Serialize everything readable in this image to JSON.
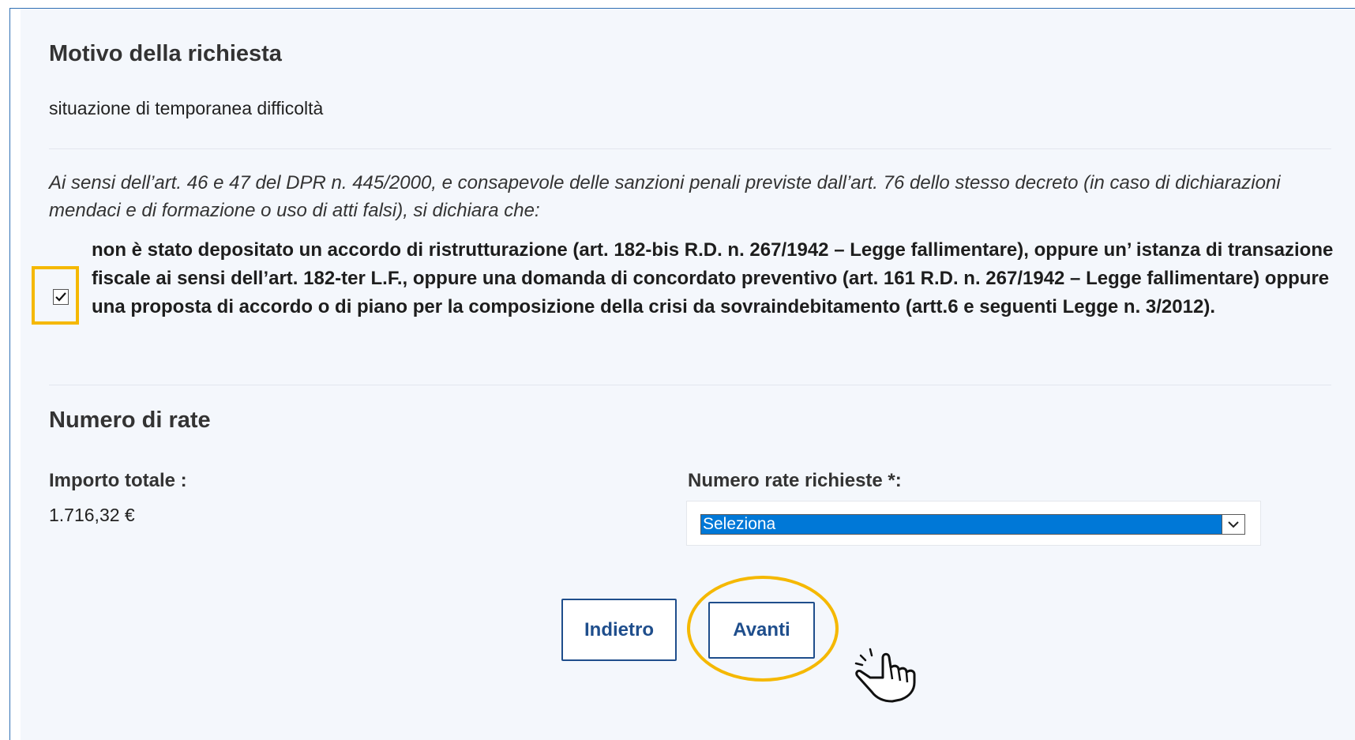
{
  "motivo": {
    "title": "Motivo della richiesta",
    "value": "situazione di temporanea difficoltà"
  },
  "declaration": {
    "intro": "Ai sensi dell’art. 46 e 47 del DPR n. 445/2000, e consapevole delle sanzioni penali previste dall’art. 76 dello stesso decreto (in caso di dichiarazioni mendaci e di formazione o uso di atti falsi), si dichiara che:",
    "checkbox_checked": true,
    "checkbox_text": "non è stato depositato un accordo di ristrutturazione (art. 182-bis R.D. n. 267/1942 – Legge fallimentare), oppure un’ istanza di transazione fiscale ai sensi dell’art. 182-ter L.F., oppure una domanda di concordato preventivo (art. 161 R.D. n. 267/1942 – Legge fallimentare) oppure una proposta di accordo o di piano per la composizione della crisi da sovraindebitamento (artt.6 e seguenti Legge n. 3/2012)."
  },
  "rate": {
    "title": "Numero di rate",
    "importo_label": "Importo totale :",
    "importo_value": "1.716,32 €",
    "numero_label": "Numero rate richieste *:",
    "numero_selected": "Seleziona"
  },
  "buttons": {
    "back_label": "Indietro",
    "next_label": "Avanti"
  },
  "colors": {
    "highlight": "#f5b800",
    "button_border": "#1f4e8c",
    "select_selected": "#0078d7",
    "panel_background": "#f4f7fc"
  },
  "icons": {
    "checkbox_mark": "checkmark-icon",
    "select_arrow": "chevron-down-icon",
    "pointer": "hand-pointer-icon"
  }
}
